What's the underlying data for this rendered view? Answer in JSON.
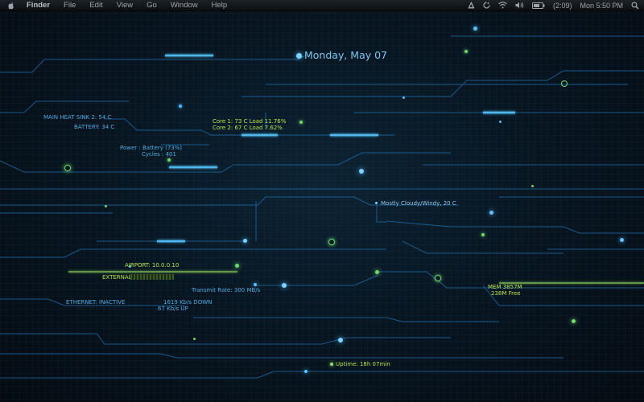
{
  "menubar": {
    "app": "Finder",
    "menus": [
      "File",
      "Edit",
      "View",
      "Go",
      "Window",
      "Help"
    ],
    "battery_time": "(2:09)",
    "clock": "Mon 5:50 PM",
    "icons": [
      "apple-icon",
      "adobe-icon",
      "sync-icon",
      "wifi-icon",
      "volume-icon",
      "battery-icon",
      "spotlight-icon"
    ]
  },
  "desktop": {
    "date": "Monday, May 07",
    "heat": {
      "sink": "MAIN HEAT SINK 2: 54 C",
      "battery": "BATTERY: 34 C"
    },
    "power": {
      "source": "Power   : Battery (73%)",
      "cycles": "Cycles : 401"
    },
    "cpu": {
      "core1": "Core 1: 73 C   Load 11.76%",
      "core2": "Core 2: 67 C   Load 7.62%"
    },
    "weather": "Mostly Cloudy/Windy, 20 C",
    "network": {
      "airport": "AIRPORT: 10.0.0.10",
      "external": "EXTERNAL:",
      "ethernet": "ETHERNET: INACTIVE",
      "transmit": "Transmit Rate: 300 MB/s",
      "down": "1619 Kb/s DOWN",
      "up": "67 Kb/s UP"
    },
    "memory": {
      "used": "MEM 3857M",
      "free": "238M Free"
    },
    "uptime": "Uptime: 18h 07min"
  }
}
